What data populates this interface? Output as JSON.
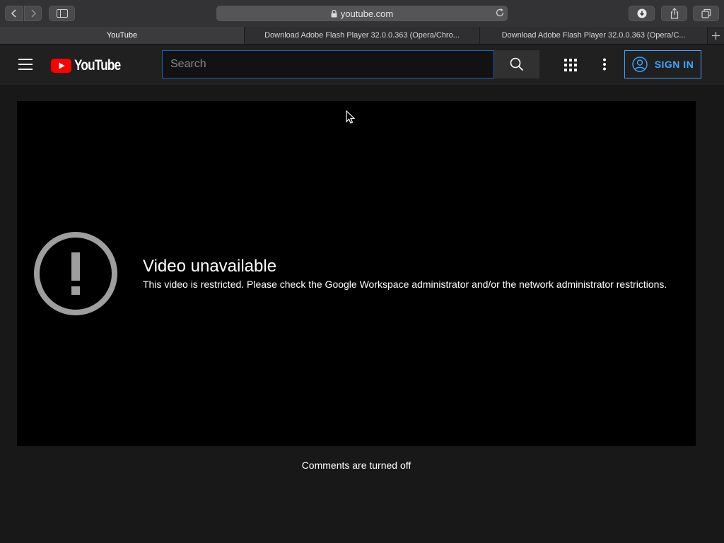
{
  "browser": {
    "url": "youtube.com",
    "tabs": [
      {
        "label": "YouTube",
        "active": true
      },
      {
        "label": "Download Adobe Flash Player 32.0.0.363 (Opera/Chro...",
        "active": false
      },
      {
        "label": "Download Adobe Flash Player 32.0.0.363 (Opera/C...",
        "active": false
      }
    ]
  },
  "masthead": {
    "logo_text": "YouTube",
    "search_placeholder": "Search",
    "sign_in_label": "SIGN IN"
  },
  "player": {
    "error_title": "Video unavailable",
    "error_message": "This video is restricted. Please check the Google Workspace administrator and/or the network administrator restrictions."
  },
  "comments_status": "Comments are turned off",
  "colors": {
    "accent": "#3ea6ff",
    "brand_red": "#ff0000",
    "background": "#181818"
  }
}
